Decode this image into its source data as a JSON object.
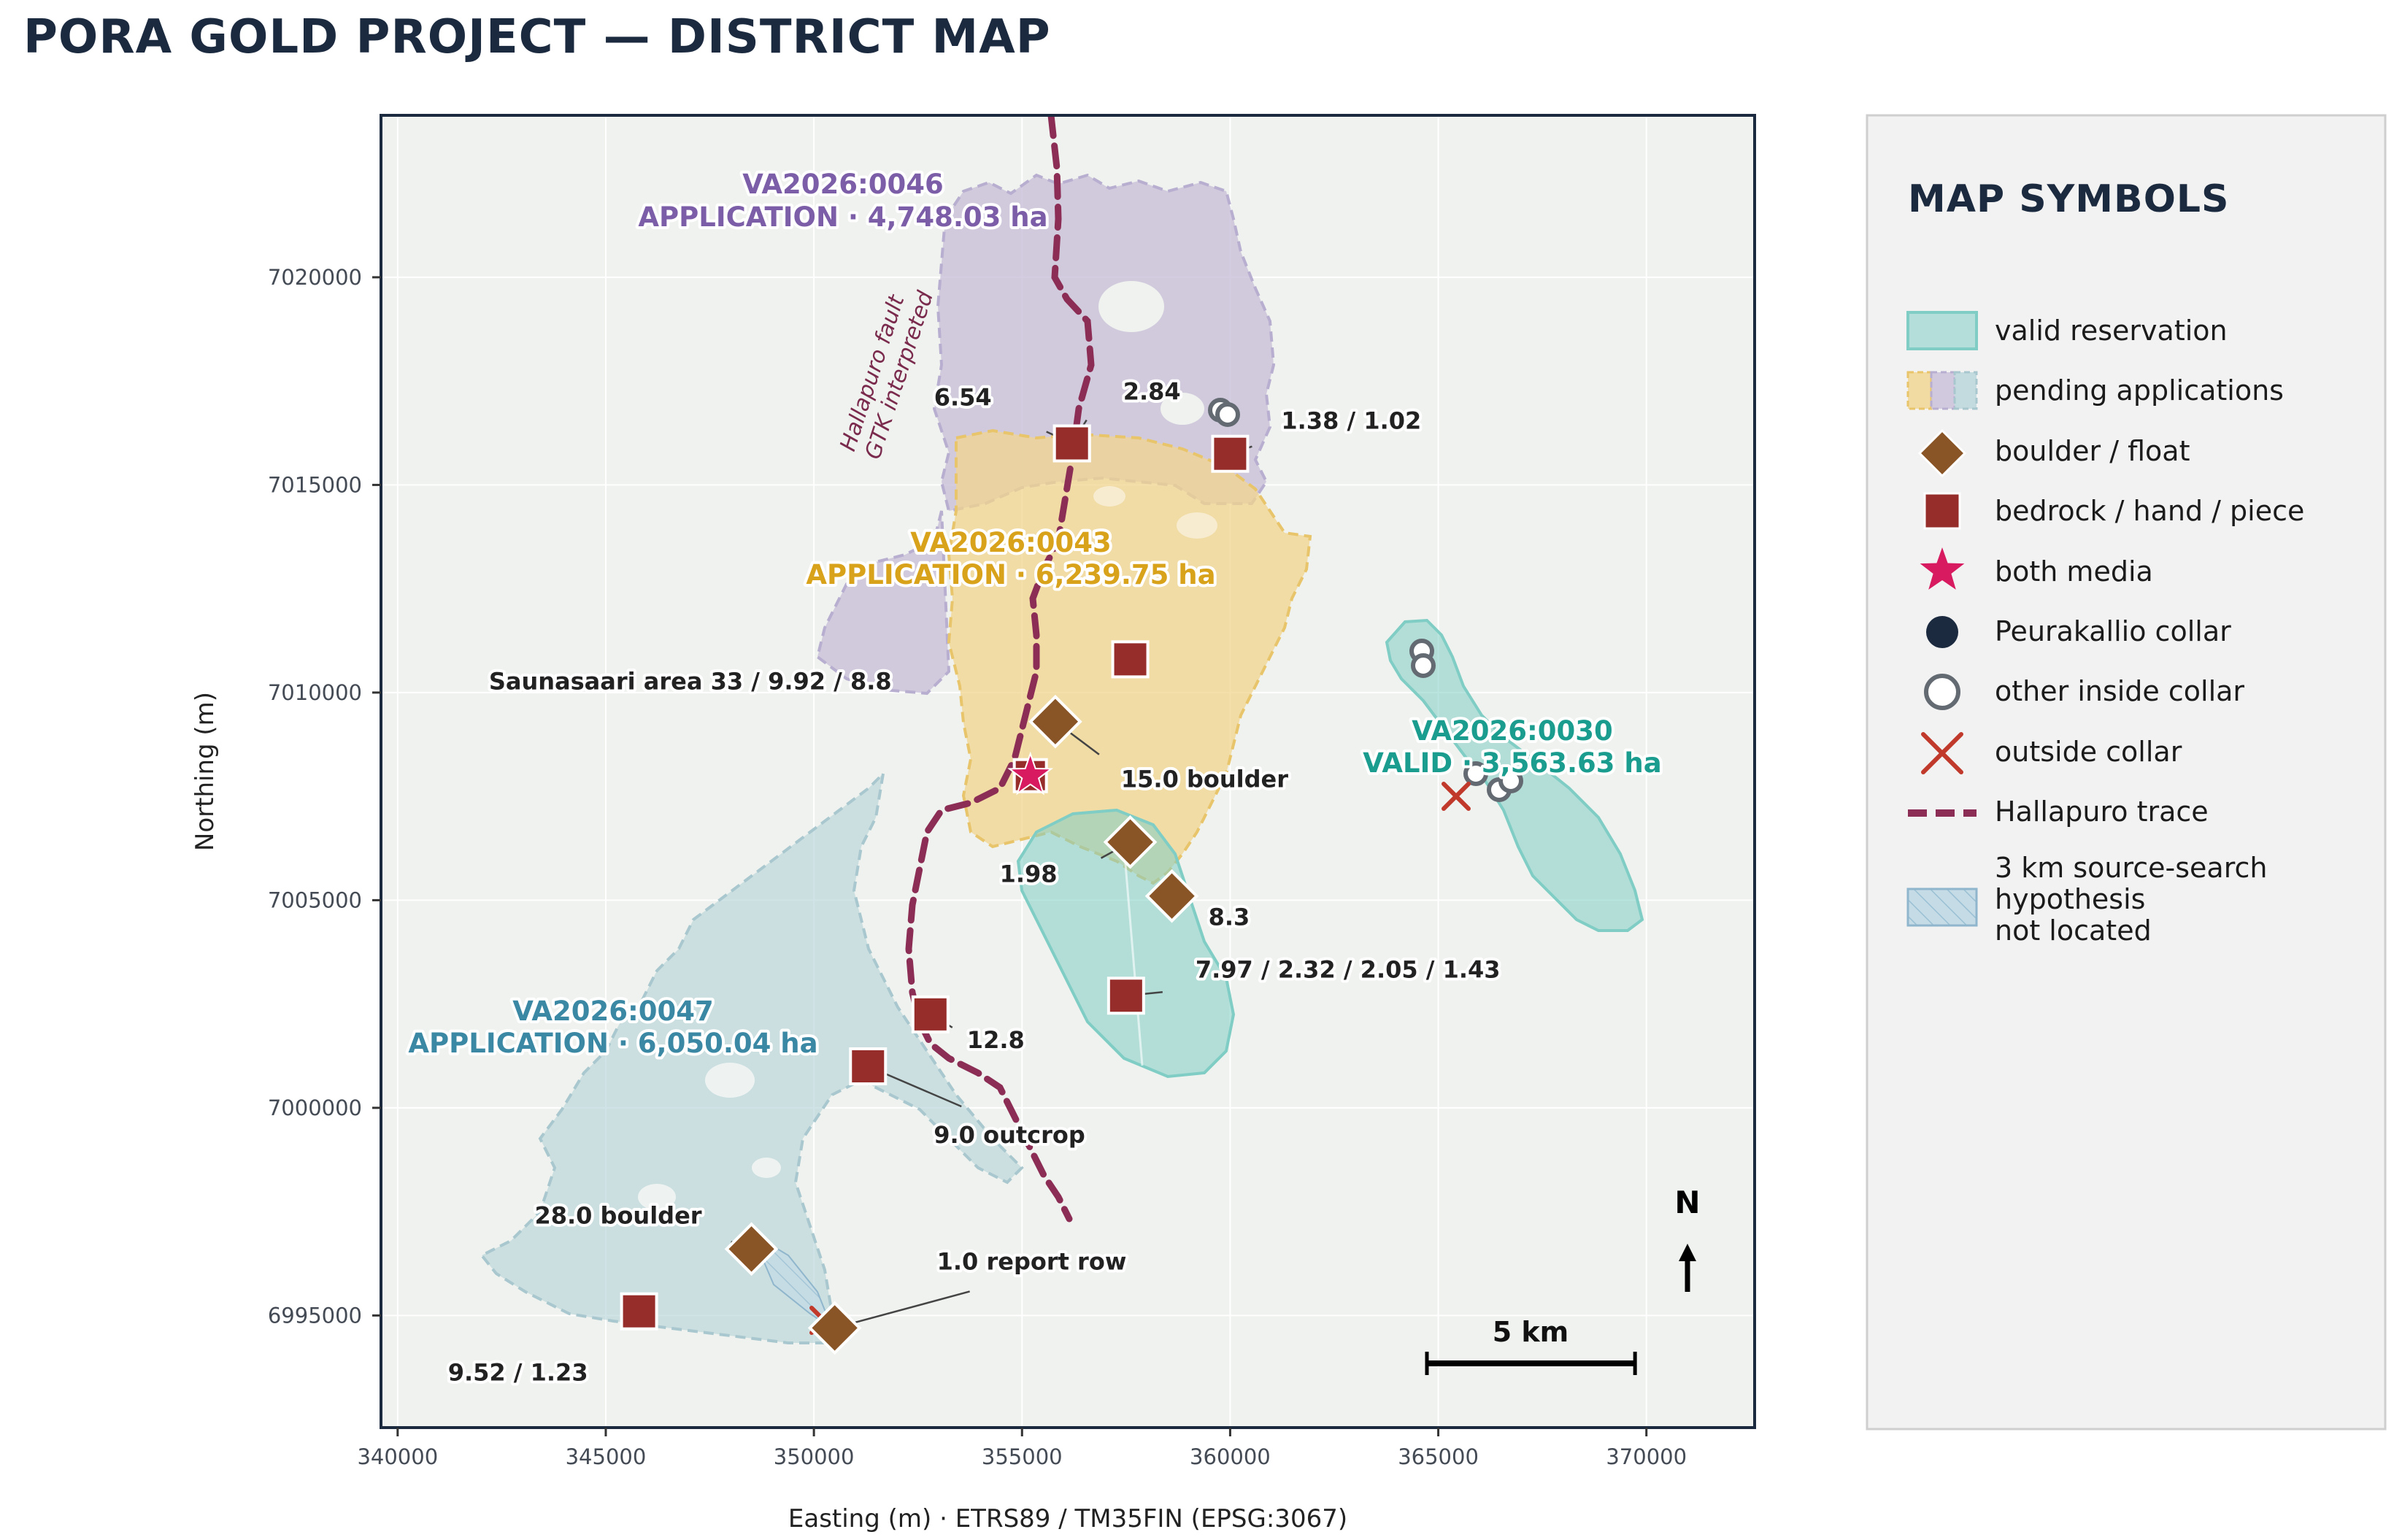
{
  "title": "PORA GOLD PROJECT — DISTRICT MAP",
  "axes": {
    "xlabel": "Easting (m) · ETRS89 / TM35FIN (EPSG:3067)",
    "ylabel": "Northing (m)",
    "xlim": [
      339600,
      372600
    ],
    "ylim": [
      6992300,
      7023900
    ],
    "xticks": [
      "340000",
      "345000",
      "350000",
      "355000",
      "360000",
      "365000",
      "370000"
    ],
    "yticks": [
      "6995000",
      "7000000",
      "7005000",
      "7010000",
      "7015000",
      "7020000"
    ]
  },
  "colors": {
    "valid": "#7fcdc4",
    "app_0046": "#c8bfd9",
    "app_0043": "#f1d48e",
    "app_0047": "#b7d4d8",
    "fault": "#8b2d54",
    "boulder": "#8a5526",
    "bedrock": "#962d2a",
    "both": "#d81b60",
    "collar_dark": "#1b2a3f",
    "outside": "#c0392b",
    "map_bg": "#eff2ee"
  },
  "tenements": [
    {
      "id": "VA2026:0046",
      "status": "APPLICATION · 4,748.03 ha",
      "color": "#7b5ea7"
    },
    {
      "id": "VA2026:0043",
      "status": "APPLICATION · 6,239.75 ha",
      "color": "#d9a21b"
    },
    {
      "id": "VA2026:0030",
      "status": "VALID · 3,563.63 ha",
      "color": "#1a9c8e"
    },
    {
      "id": "VA2026:0047",
      "status": "APPLICATION · 6,050.04 ha",
      "color": "#3a88a3"
    }
  ],
  "fault": {
    "line1": "Hallapuro fault",
    "line2": "GTK interpreted"
  },
  "samples": [
    {
      "type": "bedrock",
      "e": 356200,
      "n": 7016000,
      "label": "2.84"
    },
    {
      "type": "bedrock",
      "e": 356200,
      "n": 7016000,
      "label": "6.54"
    },
    {
      "type": "bedrock",
      "e": 360000,
      "n": 7015750,
      "label": "1.38 / 1.02"
    },
    {
      "type": "bedrock",
      "e": 357600,
      "n": 7010800,
      "label": ""
    },
    {
      "type": "both",
      "e": 355200,
      "n": 7008000,
      "label": "Saunasaari area 33 / 9.92 / 8.8"
    },
    {
      "type": "boulder",
      "e": 355800,
      "n": 7009300,
      "label": "15.0 boulder"
    },
    {
      "type": "boulder",
      "e": 357600,
      "n": 7006400,
      "label": "1.98"
    },
    {
      "type": "boulder",
      "e": 358600,
      "n": 7005100,
      "label": "8.3"
    },
    {
      "type": "bedrock",
      "e": 357500,
      "n": 7002700,
      "label": "7.97 / 2.32 / 2.05 / 1.43"
    },
    {
      "type": "bedrock",
      "e": 352800,
      "n": 7002250,
      "label": "12.8"
    },
    {
      "type": "bedrock",
      "e": 351300,
      "n": 7001000,
      "label": "9.0 outcrop"
    },
    {
      "type": "boulder",
      "e": 348500,
      "n": 6996600,
      "label": "28.0 boulder"
    },
    {
      "type": "bedrock",
      "e": 345800,
      "n": 6995100,
      "label": "9.52 / 1.23"
    },
    {
      "type": "boulder",
      "e": 350500,
      "n": 6994700,
      "label": "1.0 report row"
    }
  ],
  "scale_bar": {
    "label": "5 km",
    "length_m": 5000
  },
  "north_arrow": {
    "label": "N"
  },
  "legend": {
    "title": "MAP SYMBOLS",
    "items": [
      {
        "label": "valid reservation",
        "symbol": "valid-fill"
      },
      {
        "label": "pending applications",
        "symbol": "pending-fill"
      },
      {
        "label": "boulder / float",
        "symbol": "diamond"
      },
      {
        "label": "bedrock / hand / piece",
        "symbol": "square"
      },
      {
        "label": "both media",
        "symbol": "star"
      },
      {
        "label": "Peurakallio collar",
        "symbol": "filled-circle"
      },
      {
        "label": "other inside collar",
        "symbol": "open-circle"
      },
      {
        "label": "outside collar",
        "symbol": "cross"
      },
      {
        "label": "Hallapuro trace",
        "symbol": "dashed-line"
      }
    ],
    "hypothesis_lines": [
      "3 km source-search",
      "hypothesis",
      "not located"
    ]
  }
}
